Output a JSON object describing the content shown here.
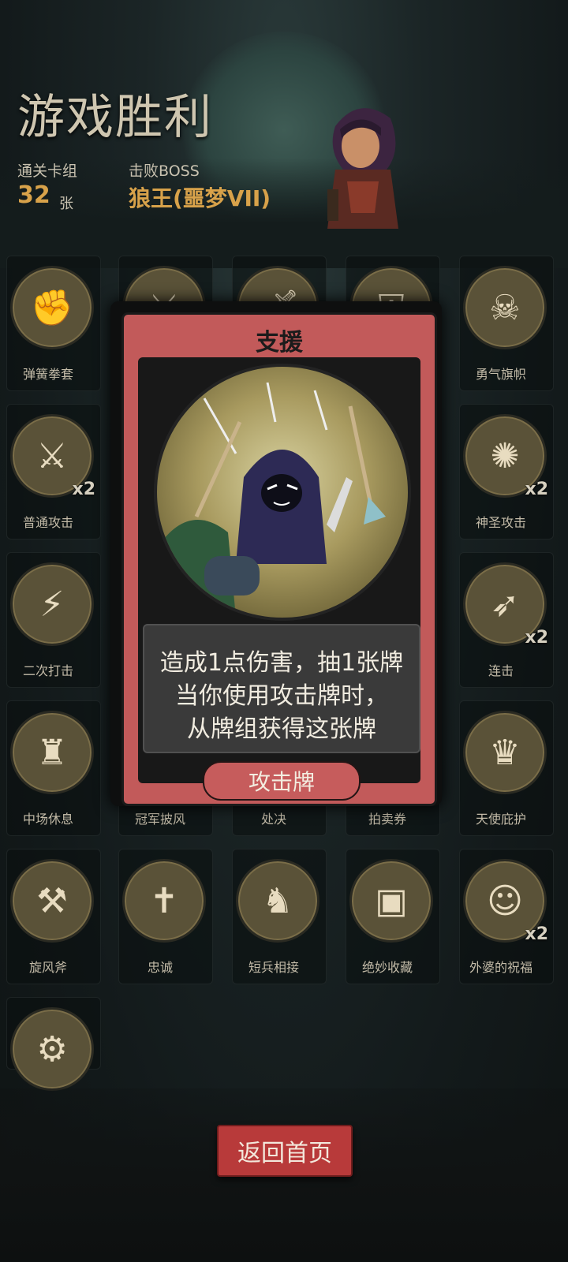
{
  "header": {
    "title": "游戏胜利",
    "deck_label": "通关卡组",
    "deck_count": "32",
    "deck_unit": "张",
    "boss_label": "击败BOSS",
    "boss_name": "狼王(噩梦VII)"
  },
  "cards": [
    {
      "name": "弹簧拳套",
      "count": "",
      "icon": "boxing-glove-icon"
    },
    {
      "name": "",
      "count": "",
      "icon": "blade-icon"
    },
    {
      "name": "",
      "count": "",
      "icon": "dagger-icon"
    },
    {
      "name": "",
      "count": "",
      "icon": "shield-icon"
    },
    {
      "name": "勇气旗帜",
      "count": "",
      "icon": "skull-banner-icon"
    },
    {
      "name": "普通攻击",
      "count": "x2",
      "icon": "sword-icon"
    },
    {
      "name": "神圣攻击",
      "count": "x2",
      "icon": "holy-light-icon"
    },
    {
      "name": "二次打击",
      "count": "",
      "icon": "double-strike-icon"
    },
    {
      "name": "连击",
      "count": "x2",
      "icon": "combo-icon"
    },
    {
      "name": "中场休息",
      "count": "",
      "icon": "rest-icon"
    },
    {
      "name": "冠军披风",
      "count": "",
      "icon": "cape-icon"
    },
    {
      "name": "处决",
      "count": "",
      "icon": "execute-icon"
    },
    {
      "name": "拍卖券",
      "count": "",
      "icon": "ticket-icon"
    },
    {
      "name": "天使庇护",
      "count": "",
      "icon": "angel-wings-icon"
    },
    {
      "name": "旋风斧",
      "count": "",
      "icon": "axe-icon"
    },
    {
      "name": "忠诚",
      "count": "",
      "icon": "cross-icon"
    },
    {
      "name": "短兵相接",
      "count": "",
      "icon": "knight-icon"
    },
    {
      "name": "绝妙收藏",
      "count": "",
      "icon": "chest-icon"
    },
    {
      "name": "外婆的祝福",
      "count": "x2",
      "icon": "granny-icon"
    },
    {
      "name": "",
      "count": "",
      "icon": "wrench-icon"
    }
  ],
  "popup": {
    "title": "支援",
    "description_lines": [
      "造成1点伤害，抽1张牌",
      "当你使用攻击牌时，",
      "从牌组获得这张牌"
    ],
    "type": "攻击牌"
  },
  "footer": {
    "back_button": "返回首页"
  }
}
